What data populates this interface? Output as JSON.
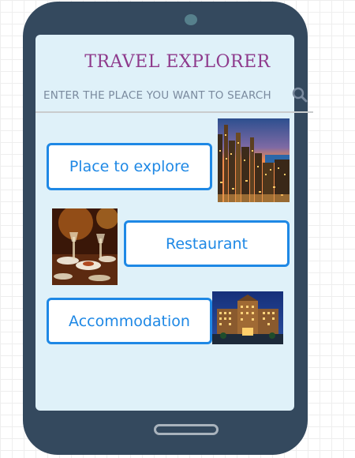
{
  "app": {
    "title": "TRAVEL EXPLORER"
  },
  "search": {
    "placeholder": "ENTER THE PLACE YOU WANT TO SEARCH",
    "icon": "search-icon"
  },
  "menu": {
    "place_label": "Place to explore",
    "restaurant_label": "Restaurant",
    "accommodation_label": "Accommodation"
  },
  "images": {
    "city": "city-skyline-image",
    "restaurant": "restaurant-dining-image",
    "hotel": "hotel-building-image"
  },
  "colors": {
    "phone_body": "#34495e",
    "screen": "#dff1f9",
    "title": "#8e3a8c",
    "button_accent": "#1e88e5"
  }
}
